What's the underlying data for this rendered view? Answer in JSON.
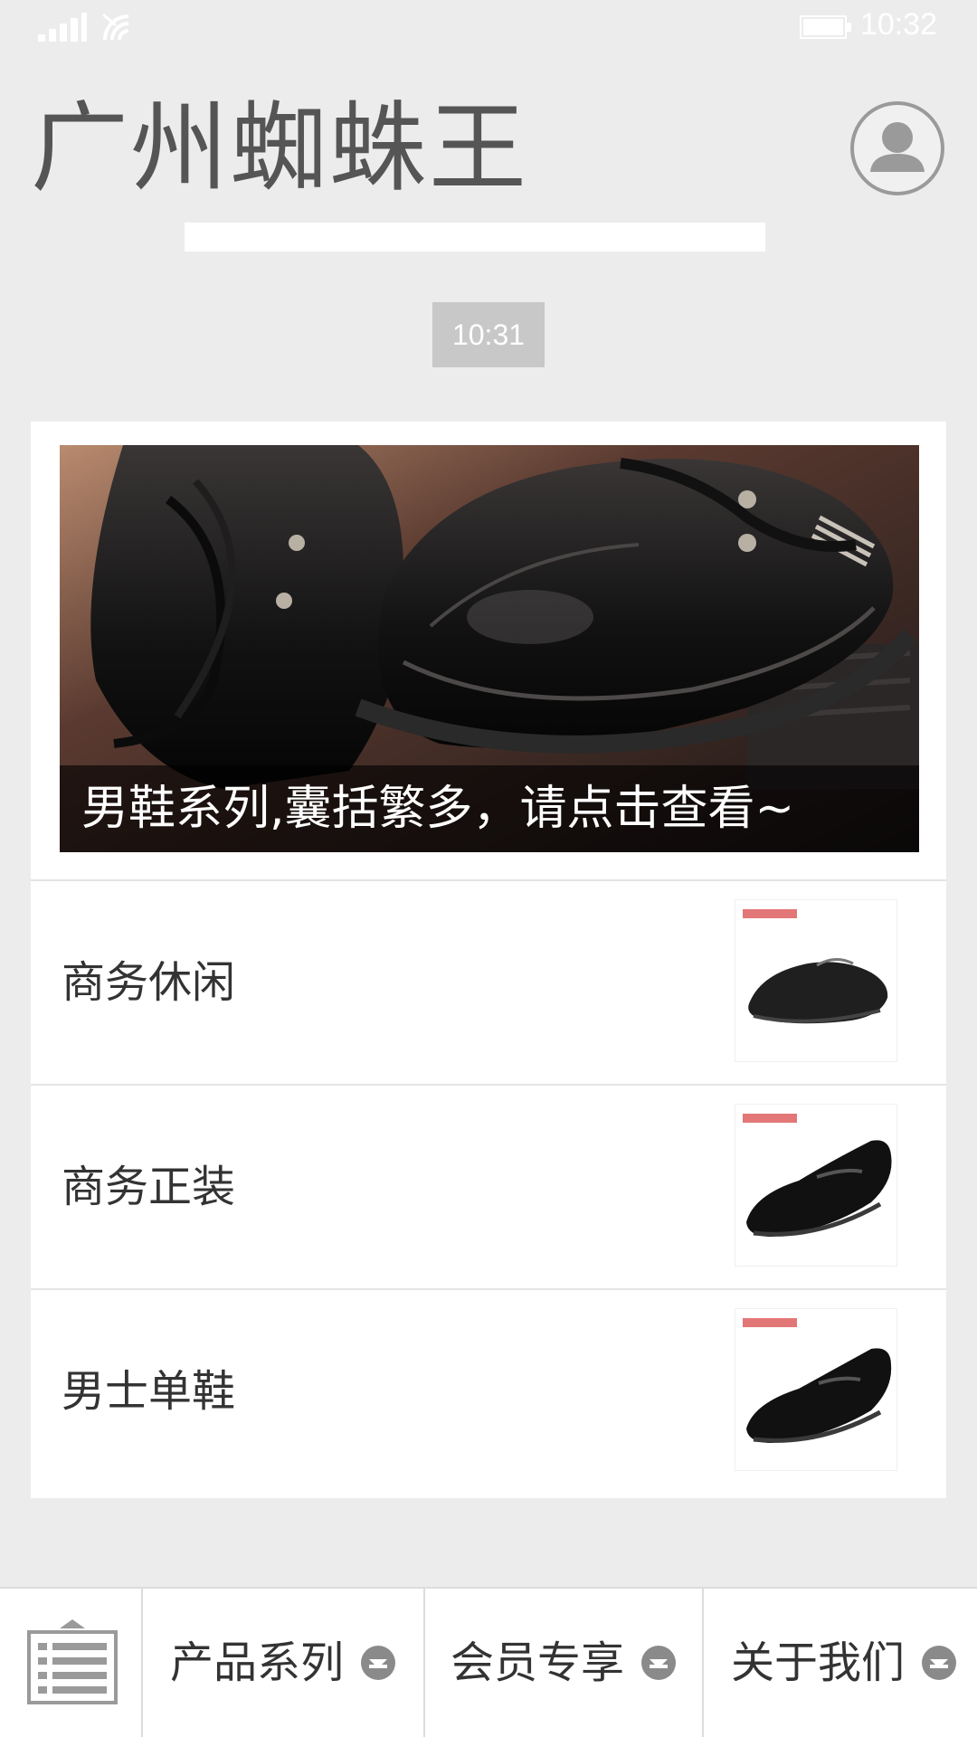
{
  "status_bar": {
    "time": "10:32",
    "signal_icon": "signal-bars-icon",
    "wifi_icon": "wifi-icon",
    "battery_icon": "battery-icon"
  },
  "header": {
    "title": "广州蜘蛛王",
    "profile_icon": "person-icon"
  },
  "chat": {
    "timestamp": "10:31"
  },
  "article_card": {
    "cover_caption": "男鞋系列,囊括繁多，请点击查看~",
    "items": [
      {
        "label": "商务休闲",
        "thumb_icon": "casual-shoe-thumbnail"
      },
      {
        "label": "商务正装",
        "thumb_icon": "formal-shoe-thumbnail"
      },
      {
        "label": "男士单鞋",
        "thumb_icon": "loafer-thumbnail"
      }
    ]
  },
  "bottom_menu": {
    "toggle_icon": "keyboard-toggle-icon",
    "items": [
      {
        "label": "产品系列",
        "icon": "submenu-arrow-icon"
      },
      {
        "label": "会员专享",
        "icon": "submenu-arrow-icon"
      },
      {
        "label": "关于我们",
        "icon": "submenu-arrow-icon"
      }
    ]
  },
  "colors": {
    "background": "#ececec",
    "card": "#ffffff",
    "title": "#555555",
    "timestamp_bg": "#c8c8c8"
  }
}
